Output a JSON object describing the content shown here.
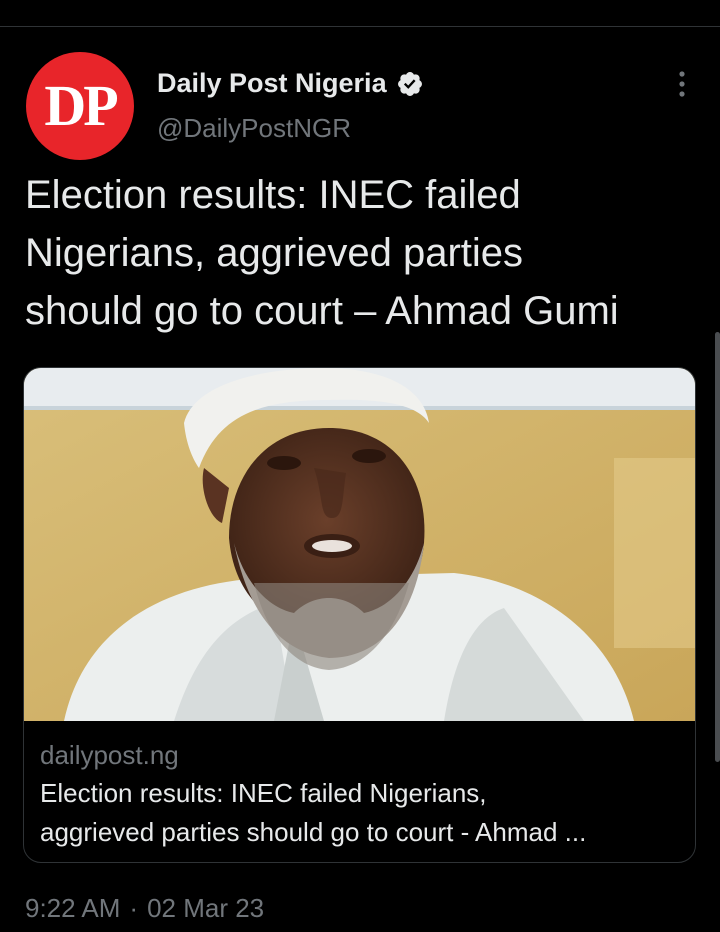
{
  "account": {
    "avatar_text": "DP",
    "display_name": "Daily Post Nigeria",
    "handle": "@DailyPostNGR",
    "verified": true
  },
  "tweet": {
    "text_lines": [
      "Election results: INEC failed",
      "Nigerians, aggrieved parties",
      "should go to court – Ahmad Gumi"
    ]
  },
  "link_card": {
    "domain": "dailypost.ng",
    "title_lines": [
      "Election results: INEC failed Nigerians,",
      "aggrieved parties should go to court - Ahmad ..."
    ]
  },
  "meta": {
    "time": "9:22 AM",
    "separator": "·",
    "date": "02 Mar 23"
  },
  "icons": {
    "verified": "verified-badge-icon",
    "more": "more-options-icon"
  },
  "colors": {
    "background": "#000000",
    "text_primary": "#e7e9ea",
    "text_secondary": "#71767b",
    "avatar_red": "#e8252a",
    "border": "#2f3336"
  }
}
